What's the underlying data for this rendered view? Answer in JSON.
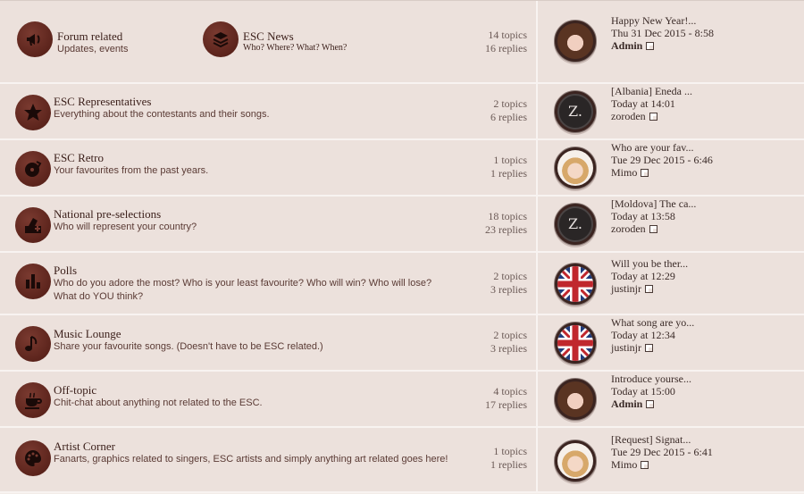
{
  "forums": [
    {
      "title": "Forum related",
      "desc": "Updates, events",
      "icon": "megaphone-icon",
      "subforum": {
        "title": "ESC News",
        "desc": "Who? Where? What? When?",
        "icon": "stack-icon"
      },
      "topics": "14 topics",
      "replies": "16 replies",
      "last": {
        "title": "Happy New Year!...",
        "date": "Thu 31 Dec 2015 - 8:58",
        "user": "Admin",
        "avatar": "girl"
      }
    },
    {
      "title": "ESC Representatives",
      "desc": "Everything about the contestants and their songs.",
      "icon": "star-icon",
      "topics": "2 topics",
      "replies": "6 replies",
      "last": {
        "title": "[Albania] Eneda ...",
        "date": "Today at 14:01",
        "user": "zoroden",
        "avatar": "z"
      }
    },
    {
      "title": "ESC Retro",
      "desc": "Your favourites from the past years.",
      "icon": "vinyl-icon",
      "topics": "1 topics",
      "replies": "1 replies",
      "last": {
        "title": "Who are your fav...",
        "date": "Tue 29 Dec 2015 - 6:46",
        "user": "Mimo",
        "avatar": "blonde"
      }
    },
    {
      "title": "National pre-selections",
      "desc": "Who will represent your country?",
      "icon": "ballot-icon",
      "topics": "18 topics",
      "replies": "23 replies",
      "last": {
        "title": "[Moldova] The ca...",
        "date": "Today at 13:58",
        "user": "zoroden",
        "avatar": "z"
      }
    },
    {
      "title": "Polls",
      "desc": "Who do you adore the most? Who is your least favourite? Who will win? Who will lose? What do YOU think?",
      "icon": "bar-chart-icon",
      "topics": "2 topics",
      "replies": "3 replies",
      "last": {
        "title": "Will you be ther...",
        "date": "Today at 12:29",
        "user": "justinjr",
        "avatar": "uk"
      }
    },
    {
      "title": "Music Lounge",
      "desc": "Share your favourite songs. (Doesn't have to be ESC related.)",
      "icon": "music-note-icon",
      "topics": "2 topics",
      "replies": "3 replies",
      "last": {
        "title": "What song are yo...",
        "date": "Today at 12:34",
        "user": "justinjr",
        "avatar": "uk"
      }
    },
    {
      "title": "Off-topic",
      "desc": "Chit-chat about anything not related to the ESC.",
      "icon": "coffee-cup-icon",
      "topics": "4 topics",
      "replies": "17 replies",
      "last": {
        "title": "Introduce yourse...",
        "date": "Today at 15:00",
        "user": "Admin",
        "avatar": "girl"
      }
    },
    {
      "title": "Artist Corner",
      "desc": "Fanarts, graphics related to singers, ESC artists and simply anything art related goes here!",
      "icon": "palette-icon",
      "topics": "1 topics",
      "replies": "1 replies",
      "last": {
        "title": "[Request] Signat...",
        "date": "Tue 29 Dec 2015 - 6:41",
        "user": "Mimo",
        "avatar": "blonde"
      }
    }
  ]
}
